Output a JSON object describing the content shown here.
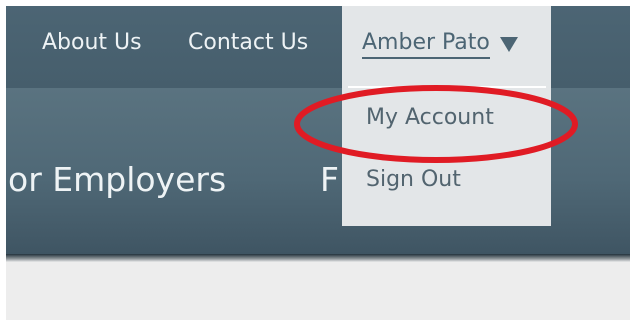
{
  "nav": {
    "about": "About Us",
    "contact": "Contact Us",
    "user_name": "Amber Pato",
    "caret_icon": "caret-down-icon"
  },
  "dropdown": {
    "items": [
      "My Account",
      "Sign Out"
    ]
  },
  "banner": {
    "employers": "or Employers",
    "next_fragment": "F"
  },
  "annotation": {
    "highlight_color": "#e01b24"
  },
  "colors": {
    "header_bg": "#4c6574",
    "menu_bg": "#e3e6e8",
    "page_bg": "#ededed"
  }
}
